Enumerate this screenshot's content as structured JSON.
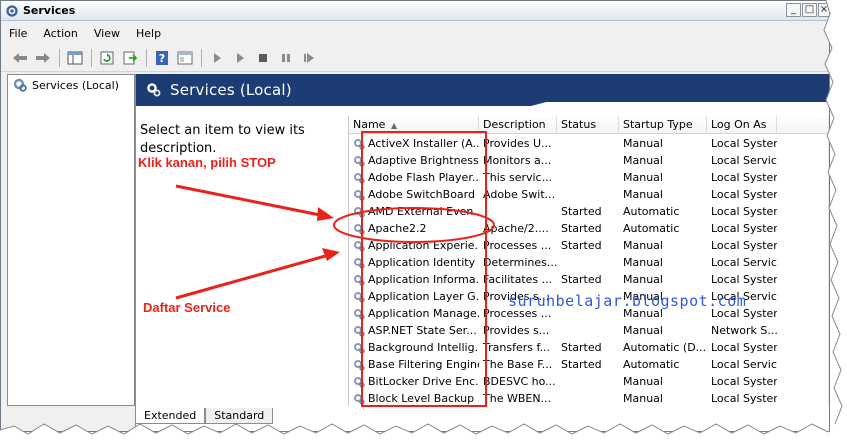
{
  "window": {
    "title": "Services",
    "controls": [
      "_",
      "□",
      "×"
    ]
  },
  "menu": [
    "File",
    "Action",
    "View",
    "Help"
  ],
  "toolbar_icons": [
    "back-arrow-icon",
    "forward-arrow-icon",
    "console-tree-icon",
    "refresh-icon",
    "export-icon",
    "help-icon",
    "properties-icon",
    "play-icon",
    "play-alt-icon",
    "stop-icon",
    "pause-icon",
    "restart-icon"
  ],
  "tree": {
    "root_label": "Services (Local)"
  },
  "pane": {
    "header_title": "Services (Local)",
    "description": "Select an item to view its description."
  },
  "list": {
    "columns": [
      "Name",
      "Description",
      "Status",
      "Startup Type",
      "Log On As"
    ],
    "rows": [
      {
        "name": "ActiveX Installer (A...",
        "desc": "Provides U...",
        "status": "",
        "startup": "Manual",
        "logon": "Local System"
      },
      {
        "name": "Adaptive Brightness",
        "desc": "Monitors a...",
        "status": "",
        "startup": "Manual",
        "logon": "Local Service"
      },
      {
        "name": "Adobe Flash Player...",
        "desc": "This servic...",
        "status": "",
        "startup": "Manual",
        "logon": "Local System"
      },
      {
        "name": "Adobe SwitchBoard",
        "desc": "Adobe Swit...",
        "status": "",
        "startup": "Manual",
        "logon": "Local System"
      },
      {
        "name": "AMD External Even...",
        "desc": "",
        "status": "Started",
        "startup": "Automatic",
        "logon": "Local System"
      },
      {
        "name": "Apache2.2",
        "desc": "Apache/2....",
        "status": "Started",
        "startup": "Automatic",
        "logon": "Local System"
      },
      {
        "name": "Application Experie...",
        "desc": "Processes ...",
        "status": "Started",
        "startup": "Manual",
        "logon": "Local System"
      },
      {
        "name": "Application Identity",
        "desc": "Determines...",
        "status": "",
        "startup": "Manual",
        "logon": "Local Service"
      },
      {
        "name": "Application Informa...",
        "desc": "Facilitates ...",
        "status": "Started",
        "startup": "Manual",
        "logon": "Local System"
      },
      {
        "name": "Application Layer G...",
        "desc": "Provides s...",
        "status": "",
        "startup": "Manual",
        "logon": "Local Service"
      },
      {
        "name": "Application Manage...",
        "desc": "Processes ...",
        "status": "",
        "startup": "Manual",
        "logon": "Local System"
      },
      {
        "name": "ASP.NET State Ser...",
        "desc": "Provides s...",
        "status": "",
        "startup": "Manual",
        "logon": "Network S..."
      },
      {
        "name": "Background Intellig...",
        "desc": "Transfers f...",
        "status": "Started",
        "startup": "Automatic (D...",
        "logon": "Local System"
      },
      {
        "name": "Base Filtering Engine",
        "desc": "The Base F...",
        "status": "Started",
        "startup": "Automatic",
        "logon": "Local Service"
      },
      {
        "name": "BitLocker Drive Enc...",
        "desc": "BDESVC ho...",
        "status": "",
        "startup": "Manual",
        "logon": "Local System"
      },
      {
        "name": "Block Level Backup ...",
        "desc": "The WBEN...",
        "status": "",
        "startup": "Manual",
        "logon": "Local System"
      }
    ]
  },
  "tabs": [
    "Extended",
    "Standard"
  ],
  "annotations": {
    "instruction": "Klik kanan, pilih STOP",
    "list_label": "Daftar Service",
    "watermark": "suruhbelajar.blogspot.com",
    "color": "#e8231b"
  },
  "colors": {
    "header_bg": "#1c3c73",
    "annotation_red": "#e8231b",
    "watermark_blue": "#2e5bd6"
  }
}
